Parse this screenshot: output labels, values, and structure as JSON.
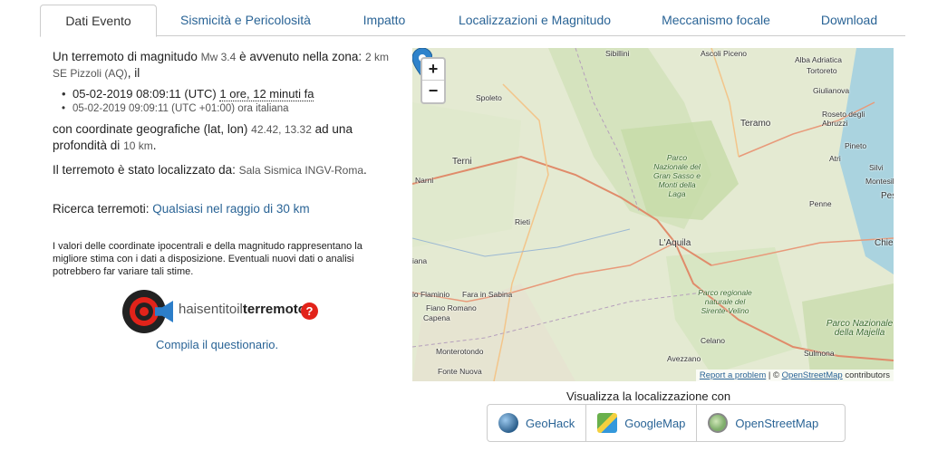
{
  "tabs": [
    {
      "label": "Dati Evento",
      "active": true
    },
    {
      "label": "Sismicità e Pericolosità"
    },
    {
      "label": "Impatto"
    },
    {
      "label": "Localizzazioni e Magnitudo"
    },
    {
      "label": "Meccanismo focale"
    },
    {
      "label": "Download"
    }
  ],
  "event": {
    "intro_a": "Un terremoto di magnitudo",
    "magnitude": "Mw 3.4",
    "intro_b": "è avvenuto nella zona:",
    "zone": "2 km SE Pizzoli (AQ)",
    "intro_c": ", il",
    "time_utc": "05-02-2019 08:09:11 (UTC)",
    "time_ago": "1 ore, 12 minuti fa",
    "time_local": "05-02-2019 09:09:11 (UTC +01:00) ora italiana",
    "coord_a": "con coordinate geografiche (lat, lon)",
    "coords": "42.42, 13.32",
    "coord_b": "ad una profondità di",
    "depth": "10 km",
    "coord_c": ".",
    "loc_a": "Il terremoto è stato localizzato da:",
    "loc_by": "Sala Sismica INGV-Roma",
    "loc_c": ".",
    "search_label": "Ricerca terremoti:",
    "search_link": "Qualsiasi nel raggio di 30 km",
    "note": "I valori delle coordinate ipocentrali e della magnitudo rappresentano la migliore stima con i dati a disposizione. Eventuali nuovi dati o analisi potrebbero far variare tali stime."
  },
  "hst": {
    "logo_text_a": "haisentito",
    "logo_text_b": "il",
    "logo_text_c": "terremoto",
    "q": "?",
    "link": "Compila il questionario."
  },
  "map": {
    "zoom_in": "+",
    "zoom_out": "−",
    "attribution_link": "Report a problem",
    "attribution_sep": " | © ",
    "attribution_osm": "OpenStreetMap",
    "attribution_tail": " contributors",
    "places": {
      "sibillini": "Sibillini",
      "ascoli": "Ascoli Piceno",
      "alba": "Alba Adriatica",
      "tortoreto": "Tortoreto",
      "giulianova": "Giulianova",
      "roseto": "Roseto degli Abruzzi",
      "spoleto": "Spoleto",
      "teramo": "Teramo",
      "pineto": "Pineto",
      "atri": "Atri",
      "silvi": "Silvi",
      "montesilvano": "Montesilv",
      "pe": "Pes",
      "terni": "Terni",
      "narni": "Narni",
      "gran_sasso": "Parco Nazionale del Gran Sasso e Monti della Laga",
      "penne": "Penne",
      "rieti": "Rieti",
      "laquila": "L'Aquila",
      "chie": "Chie",
      "iana": "iana",
      "flaminio": "io Flaminio",
      "fara": "Fara in Sabina",
      "fiano": "Fiano Romano",
      "capena": "Capena",
      "sirente": "Parco regionale naturale del Sirente-Velino",
      "majella": "Parco Nazionale della Majella",
      "celano": "Celano",
      "monterotondo": "Monterotondo",
      "avezzano": "Avezzano",
      "sulmona": "Sulmona",
      "fonte": "Fonte Nuova"
    }
  },
  "visualizza": {
    "title": "Visualizza la localizzazione con",
    "buttons": [
      {
        "label": "GeoHack",
        "icon": "globe-icon"
      },
      {
        "label": "GoogleMap",
        "icon": "google-map-icon"
      },
      {
        "label": "OpenStreetMap",
        "icon": "osm-icon"
      }
    ]
  }
}
